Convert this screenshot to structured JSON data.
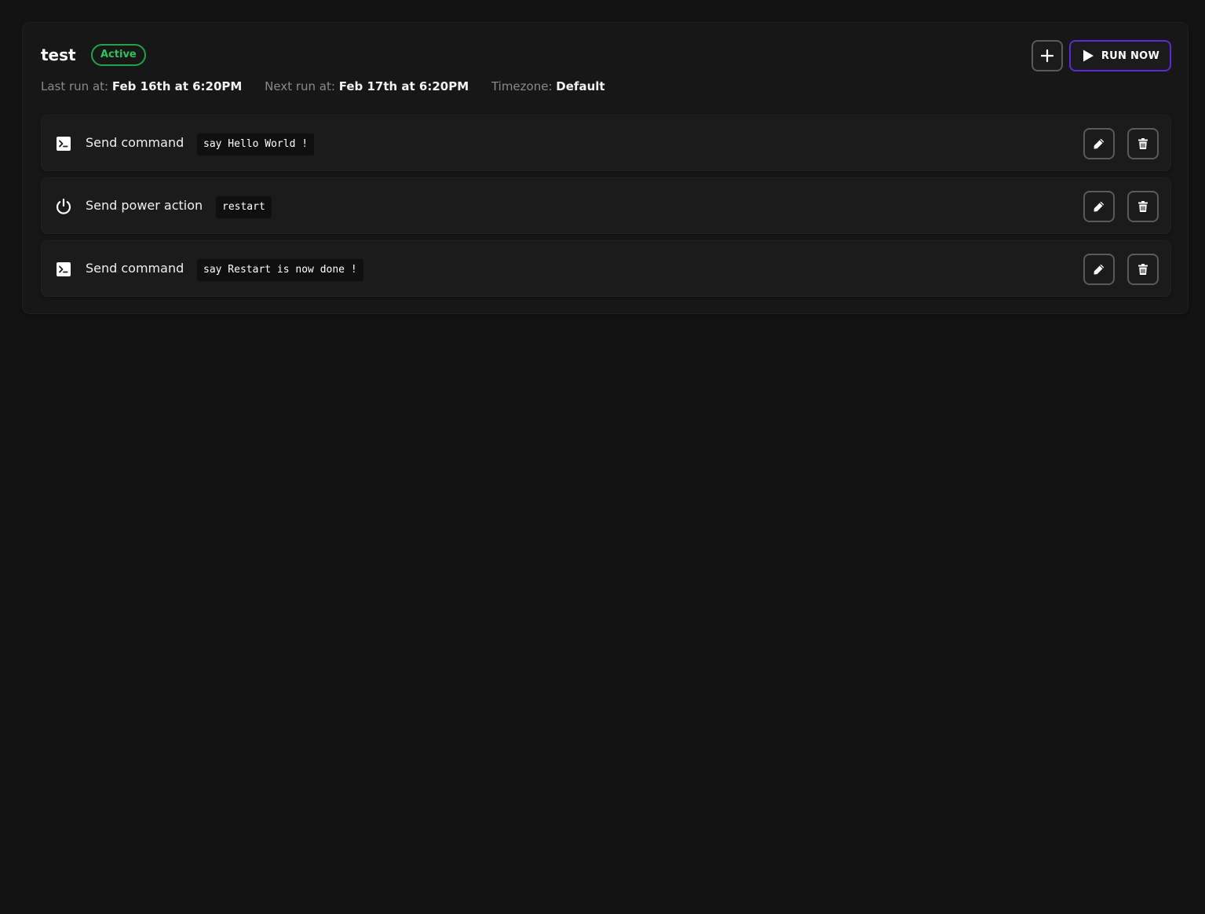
{
  "schedule": {
    "title": "test",
    "status": "Active",
    "last_run_label": "Last run at:",
    "last_run_value": "Feb 16th at 6:20PM",
    "next_run_label": "Next run at:",
    "next_run_value": "Feb 17th at 6:20PM",
    "timezone_label": "Timezone:",
    "timezone_value": "Default",
    "run_now_label": "RUN NOW"
  },
  "tasks": [
    {
      "icon": "terminal-icon",
      "label": "Send command",
      "payload": "say Hello World !"
    },
    {
      "icon": "power-icon",
      "label": "Send power action",
      "payload": "restart"
    },
    {
      "icon": "terminal-icon",
      "label": "Send command",
      "payload": "say Restart is now done !"
    }
  ],
  "colors": {
    "background": "#131313",
    "card": "#171717",
    "active_badge": "#2fc25b",
    "run_now_border": "#5b2bd6"
  }
}
